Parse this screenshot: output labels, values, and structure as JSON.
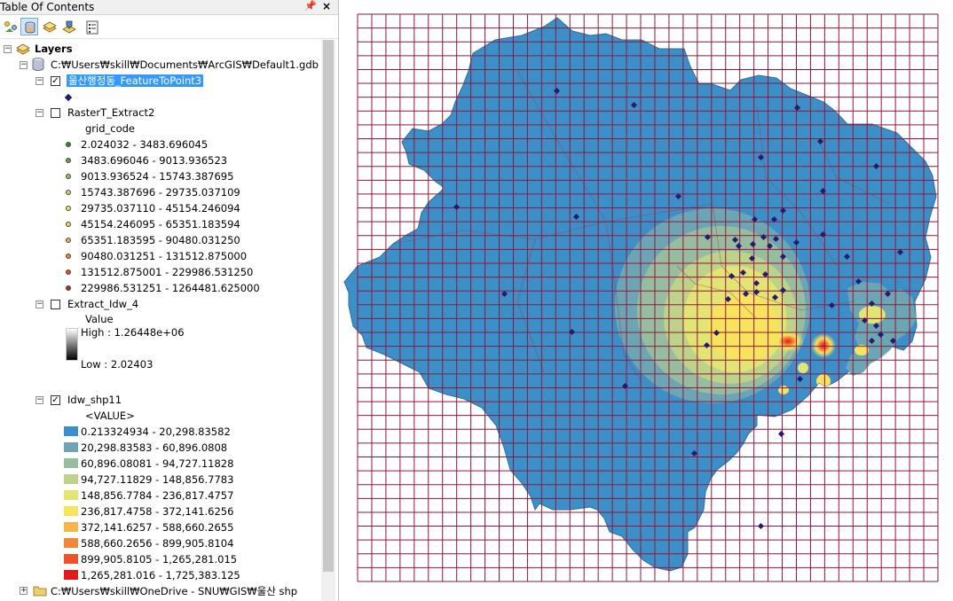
{
  "toc": {
    "title": "Table Of Contents",
    "pin": "ɹ",
    "close": "×"
  },
  "toolbar": {
    "buttons": [
      {
        "name": "list-by-drawing-order-icon"
      },
      {
        "name": "list-by-source-icon",
        "selected": true
      },
      {
        "name": "list-by-visibility-icon"
      },
      {
        "name": "list-by-selection-icon"
      },
      {
        "name": "options-icon"
      }
    ]
  },
  "tree": {
    "layers_label": "Layers",
    "gdb_path": "C:₩Users₩skill₩Documents₩ArcGIS₩Default1.gdb",
    "point_layer": "울산행정동_FeatureToPoint3",
    "raster_layer": "RasterT_Extract2",
    "grid_field": "grid_code",
    "grid_classes": [
      {
        "label": "2.024032 - 3483.696045",
        "color": "#3a8a2c"
      },
      {
        "label": "3483.696046 - 9013.936523",
        "color": "#5ea83c"
      },
      {
        "label": "9013.936524 - 15743.387695",
        "color": "#8cc84b"
      },
      {
        "label": "15743.387696 - 29735.037109",
        "color": "#bfdc4e"
      },
      {
        "label": "29735.037110 - 45154.246094",
        "color": "#e6ee3d"
      },
      {
        "label": "45154.246095 - 65351.183594",
        "color": "#ffd733"
      },
      {
        "label": "65351.183595 - 90480.031250",
        "color": "#ffab2e"
      },
      {
        "label": "90480.031251 - 131512.875000",
        "color": "#ff7a24"
      },
      {
        "label": "131512.875001 - 229986.531250",
        "color": "#f2461d"
      },
      {
        "label": "229986.531251 - 1264481.625000",
        "color": "#d7191c"
      }
    ],
    "idw_extract_layer": "Extract_Idw_4",
    "value_label": "Value",
    "high_label": "High : 1.26448e+06",
    "low_label": "Low : 2.02403",
    "idw_layer": "Idw_shp11",
    "value_field": "<VALUE>",
    "idw_classes": [
      {
        "label": "0.213324934 - 20,298.83582",
        "color": "#3d8fc9"
      },
      {
        "label": "20,298.83583 - 60,896.0808",
        "color": "#6ca6b5"
      },
      {
        "label": "60,896.08081 - 94,727.11828",
        "color": "#97bda0"
      },
      {
        "label": "94,727.11829 - 148,856.7783",
        "color": "#bdd38a"
      },
      {
        "label": "148,856.7784 - 236,817.4757",
        "color": "#e2e574"
      },
      {
        "label": "236,817.4758 - 372,141.6256",
        "color": "#f7e35e"
      },
      {
        "label": "372,141.6257 - 588,660.2655",
        "color": "#f8b54a"
      },
      {
        "label": "588,660.2656 - 899,905.8104",
        "color": "#f58639"
      },
      {
        "label": "899,905.8105 - 1,265,281.015",
        "color": "#ee5228"
      },
      {
        "label": "1,265,281.016 - 1,725,383.125",
        "color": "#e31a1c"
      }
    ],
    "folder_path": "C:₩Users₩skill₩OneDrive - SNU₩GIS₩울산 shp"
  },
  "map": {
    "grid_color": "#8b1a3a",
    "base_color": "#3d8fc9",
    "point_color": "#2a1a6e"
  }
}
